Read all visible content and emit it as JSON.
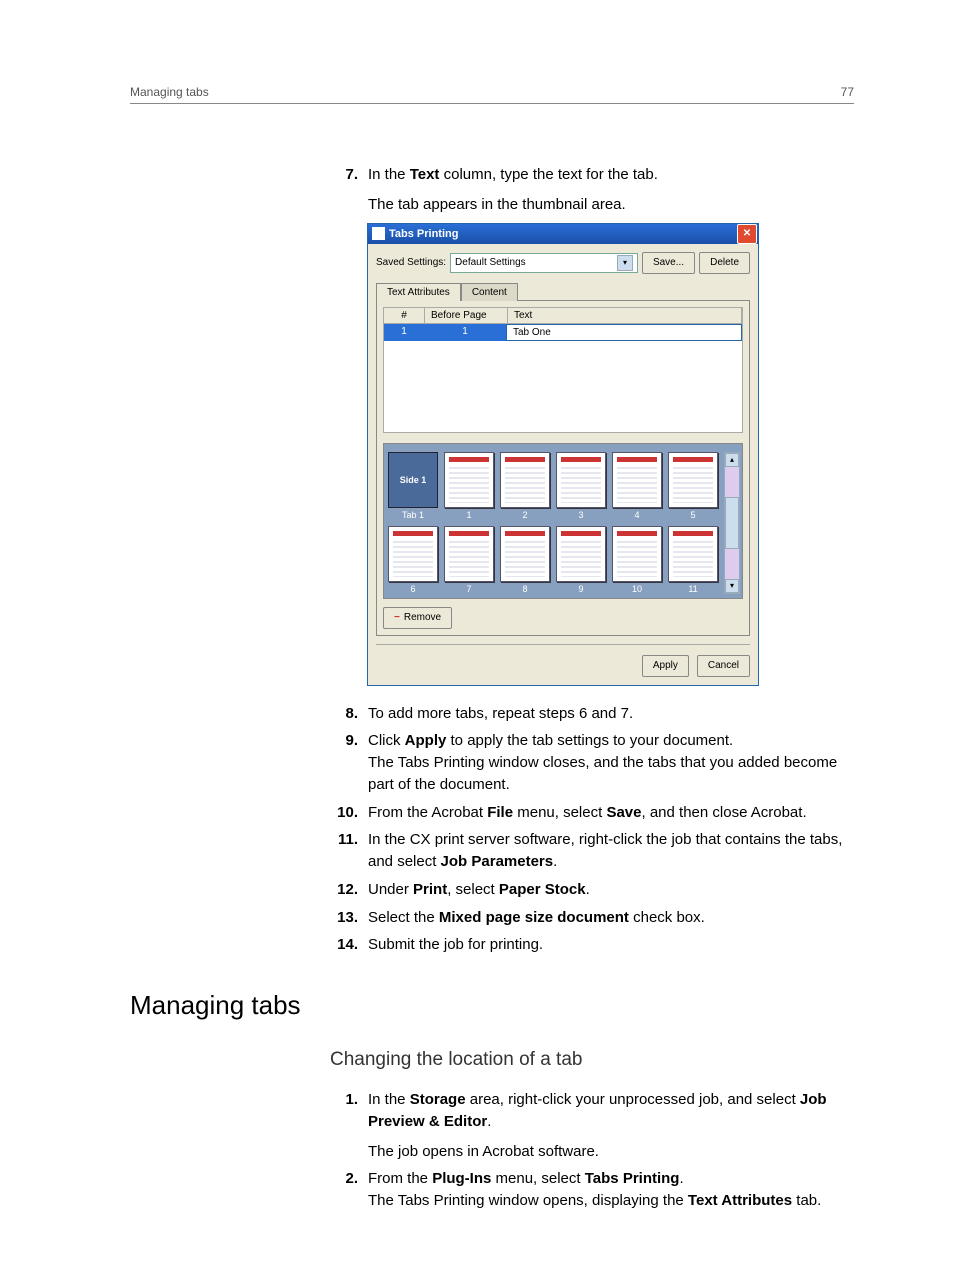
{
  "header": {
    "left": "Managing tabs",
    "right": "77"
  },
  "steps_a": {
    "7": {
      "num": "7.",
      "line1_a": "In the ",
      "line1_b": "Text",
      "line1_c": " column, type the text for the tab.",
      "line2": "The tab appears in the thumbnail area."
    },
    "8": {
      "num": "8.",
      "text": "To add more tabs, repeat steps 6 and 7."
    },
    "9": {
      "num": "9.",
      "l1a": "Click ",
      "l1b": "Apply",
      "l1c": " to apply the tab settings to your document.",
      "l2": "The Tabs Printing window closes, and the tabs that you added become part of the document."
    },
    "10": {
      "num": "10.",
      "a": "From the Acrobat ",
      "b": "File",
      "c": " menu, select ",
      "d": "Save",
      "e": ", and then close Acrobat."
    },
    "11": {
      "num": "11.",
      "a": "In the CX print server software, right-click the job that contains the tabs, and select ",
      "b": "Job Parameters",
      "c": "."
    },
    "12": {
      "num": "12.",
      "a": "Under ",
      "b": "Print",
      "c": ", select ",
      "d": "Paper Stock",
      "e": "."
    },
    "13": {
      "num": "13.",
      "a": "Select the ",
      "b": "Mixed page size document",
      "c": " check box."
    },
    "14": {
      "num": "14.",
      "a": "Submit the job for printing."
    }
  },
  "h1": "Managing tabs",
  "h2": "Changing the location of a tab",
  "steps_b": {
    "1": {
      "num": "1.",
      "a": "In the ",
      "b": "Storage",
      "c": " area, right-click your unprocessed job, and select ",
      "d": "Job Preview & Editor",
      "e": ".",
      "l2": "The job opens in Acrobat software."
    },
    "2": {
      "num": "2.",
      "a": "From the ",
      "b": "Plug-Ins",
      "c": " menu, select ",
      "d": "Tabs Printing",
      "e": ".",
      "l2a": "The Tabs Printing window opens, displaying the ",
      "l2b": "Text Attributes",
      "l2c": " tab."
    }
  },
  "dialog": {
    "title": "Tabs Printing",
    "saved_label": "Saved Settings:",
    "saved_value": "Default Settings",
    "save_btn": "Save...",
    "delete_btn": "Delete",
    "tab_text_attr": "Text Attributes",
    "tab_content": "Content",
    "col_num": "#",
    "col_before": "Before Page",
    "col_text": "Text",
    "row1_num": "1",
    "row1_before": "1",
    "row1_text": "Tab One",
    "tab1_label": "Tab 1",
    "side1": "Side 1",
    "thumbs": [
      "1",
      "2",
      "3",
      "4",
      "5",
      "6",
      "7",
      "8",
      "9",
      "10",
      "11"
    ],
    "remove": "Remove",
    "apply": "Apply",
    "cancel": "Cancel"
  }
}
